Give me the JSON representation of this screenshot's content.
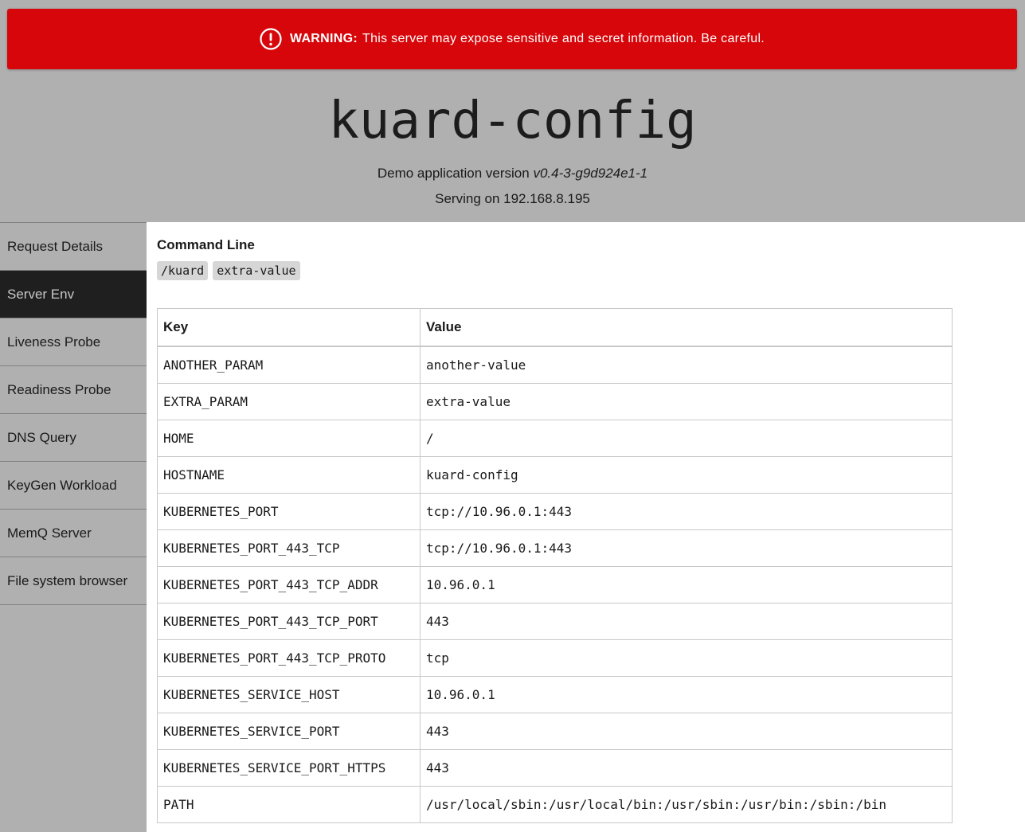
{
  "warning": {
    "icon": "exclamation-circle-icon",
    "label": "WARNING:",
    "message": "This server may expose sensitive and secret information. Be careful."
  },
  "header": {
    "title": "kuard-config",
    "version_prefix": "Demo application version",
    "version": "v0.4-3-g9d924e1-1",
    "serving": "Serving on 192.168.8.195"
  },
  "sidebar": {
    "items": [
      {
        "label": "Request Details"
      },
      {
        "label": "Server Env"
      },
      {
        "label": "Liveness Probe"
      },
      {
        "label": "Readiness Probe"
      },
      {
        "label": "DNS Query"
      },
      {
        "label": "KeyGen Workload"
      },
      {
        "label": "MemQ Server"
      },
      {
        "label": "File system browser"
      }
    ],
    "active": "Server Env"
  },
  "command_line": {
    "title": "Command Line",
    "args": [
      "/kuard",
      "extra-value"
    ]
  },
  "env_table": {
    "headers": {
      "key": "Key",
      "value": "Value"
    },
    "rows": [
      {
        "key": "ANOTHER_PARAM",
        "value": "another-value"
      },
      {
        "key": "EXTRA_PARAM",
        "value": "extra-value"
      },
      {
        "key": "HOME",
        "value": "/"
      },
      {
        "key": "HOSTNAME",
        "value": "kuard-config"
      },
      {
        "key": "KUBERNETES_PORT",
        "value": "tcp://10.96.0.1:443"
      },
      {
        "key": "KUBERNETES_PORT_443_TCP",
        "value": "tcp://10.96.0.1:443"
      },
      {
        "key": "KUBERNETES_PORT_443_TCP_ADDR",
        "value": "10.96.0.1"
      },
      {
        "key": "KUBERNETES_PORT_443_TCP_PORT",
        "value": "443"
      },
      {
        "key": "KUBERNETES_PORT_443_TCP_PROTO",
        "value": "tcp"
      },
      {
        "key": "KUBERNETES_SERVICE_HOST",
        "value": "10.96.0.1"
      },
      {
        "key": "KUBERNETES_SERVICE_PORT",
        "value": "443"
      },
      {
        "key": "KUBERNETES_SERVICE_PORT_HTTPS",
        "value": "443"
      },
      {
        "key": "PATH",
        "value": "/usr/local/sbin:/usr/local/bin:/usr/sbin:/usr/bin:/sbin:/bin"
      }
    ]
  },
  "colors": {
    "warning_bg": "#d7060a",
    "header_bg": "#b0b0b0",
    "active_nav_bg": "#1f1f1f"
  }
}
